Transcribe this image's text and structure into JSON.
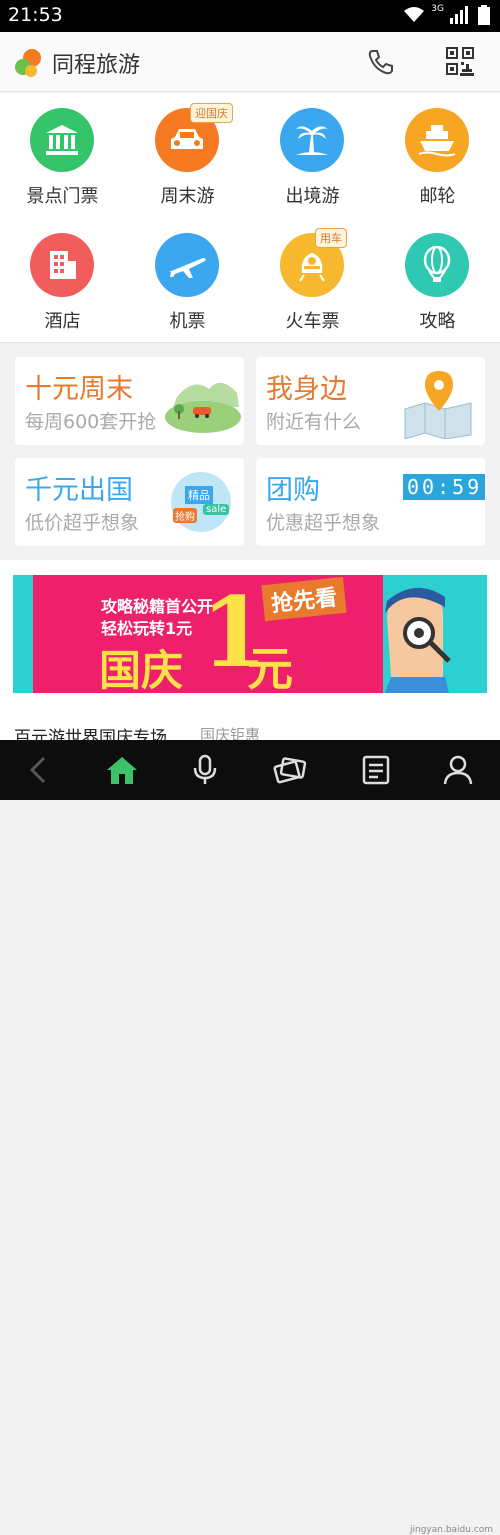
{
  "status": {
    "time": "21:53",
    "network": "3G"
  },
  "header": {
    "app_title": "同程旅游"
  },
  "grid": {
    "items": [
      {
        "label": "景点门票",
        "color": "#35c46a"
      },
      {
        "label": "周末游",
        "color": "#f57a22",
        "badge": "迎国庆"
      },
      {
        "label": "出境游",
        "color": "#3aa7ef"
      },
      {
        "label": "邮轮",
        "color": "#f6a623"
      },
      {
        "label": "酒店",
        "color": "#f15c5c"
      },
      {
        "label": "机票",
        "color": "#3aa7ef"
      },
      {
        "label": "火车票",
        "color": "#f6b82e",
        "badge": "用车"
      },
      {
        "label": "攻略",
        "color": "#2fc8b0"
      }
    ]
  },
  "promos": [
    {
      "title": "十元周末",
      "subtitle": "每周600套开抢",
      "title_color": "#e8792d"
    },
    {
      "title": "我身边",
      "subtitle": "附近有什么",
      "title_color": "#e8792d"
    },
    {
      "title": "千元出国",
      "subtitle": "低价超乎想象",
      "title_color": "#3aa7ef"
    },
    {
      "title": "团购",
      "subtitle": "优惠超乎想象",
      "title_color": "#3aa7ef",
      "countdown": "00:59"
    }
  ],
  "promo_art": {
    "tag1": "精品",
    "tag2": "抢购",
    "tag3": "sale"
  },
  "banner": {
    "line1": "攻略秘籍首公开",
    "line2": "轻松玩转1元",
    "big": "国庆",
    "one": "1",
    "yuan": "元",
    "tag": "抢先看"
  },
  "footer_section": {
    "title": "百元游世界国庆专场",
    "sub": "国庆钜惠"
  },
  "watermark": "jingyan.baidu.com"
}
